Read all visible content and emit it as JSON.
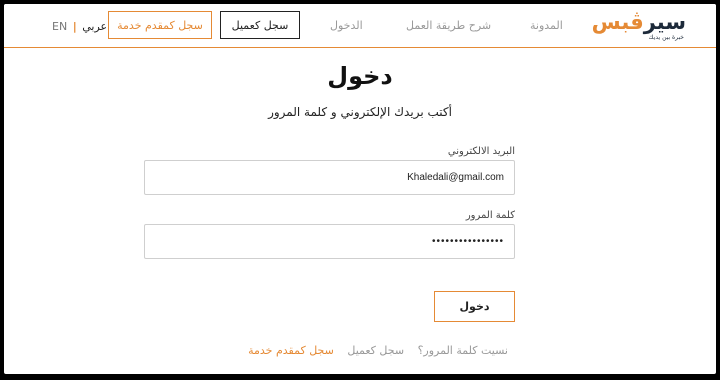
{
  "brand": {
    "logo_dark": "سير",
    "logo_orange": "ڤ",
    "logo_dark_end": "بس",
    "tagline": "خبرة بين يديك"
  },
  "nav": {
    "blog": "المدونة",
    "how_it_works": "شرح طريقة العمل",
    "login": "الدخول",
    "register_client": "سجل كعميل",
    "register_provider": "سجل كمقدم خدمة",
    "lang_en": "EN",
    "lang_sep": "|",
    "lang_ar": "عربي"
  },
  "form": {
    "title": "دخول",
    "subtitle": "أكتب بريدك الإلكتروني و كلمة المرور",
    "email_label": "البريد الالكتروني",
    "email_value": "Khaledali@gmail.com",
    "password_label": "كلمة المرور",
    "password_value": "••••••••••••••••",
    "submit": "دخول"
  },
  "footer_links": {
    "forgot": "نسيت كلمة المرور؟",
    "register_client": "سجل كعميل",
    "register_provider": "سجل كمقدم خدمة"
  },
  "colors": {
    "accent": "#e58a35",
    "dark": "#1d2a3a"
  }
}
